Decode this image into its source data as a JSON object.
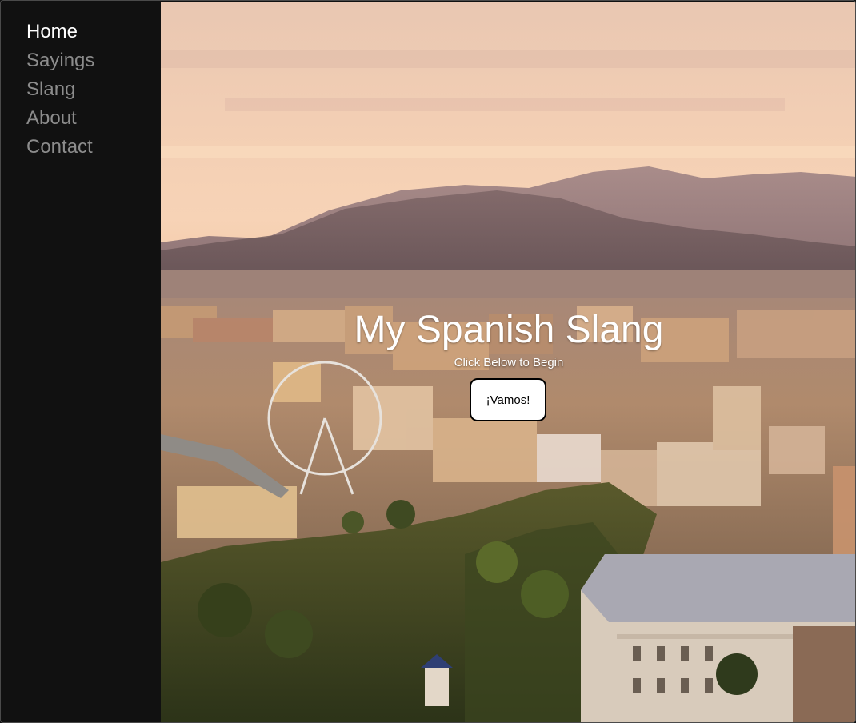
{
  "nav": {
    "items": [
      {
        "label": "Home",
        "active": true
      },
      {
        "label": "Sayings",
        "active": false
      },
      {
        "label": "Slang",
        "active": false
      },
      {
        "label": "About",
        "active": false
      },
      {
        "label": "Contact",
        "active": false
      }
    ]
  },
  "hero": {
    "title": "My Spanish Slang",
    "subtitle": "Click Below to Begin",
    "button_label": "¡Vamos!",
    "background": "city-skyline-photo"
  },
  "colors": {
    "sidebar_bg": "#111111",
    "nav_active": "#ffffff",
    "nav_inactive": "#8c8c8c",
    "button_bg": "#ffffff",
    "button_border": "#000000"
  }
}
